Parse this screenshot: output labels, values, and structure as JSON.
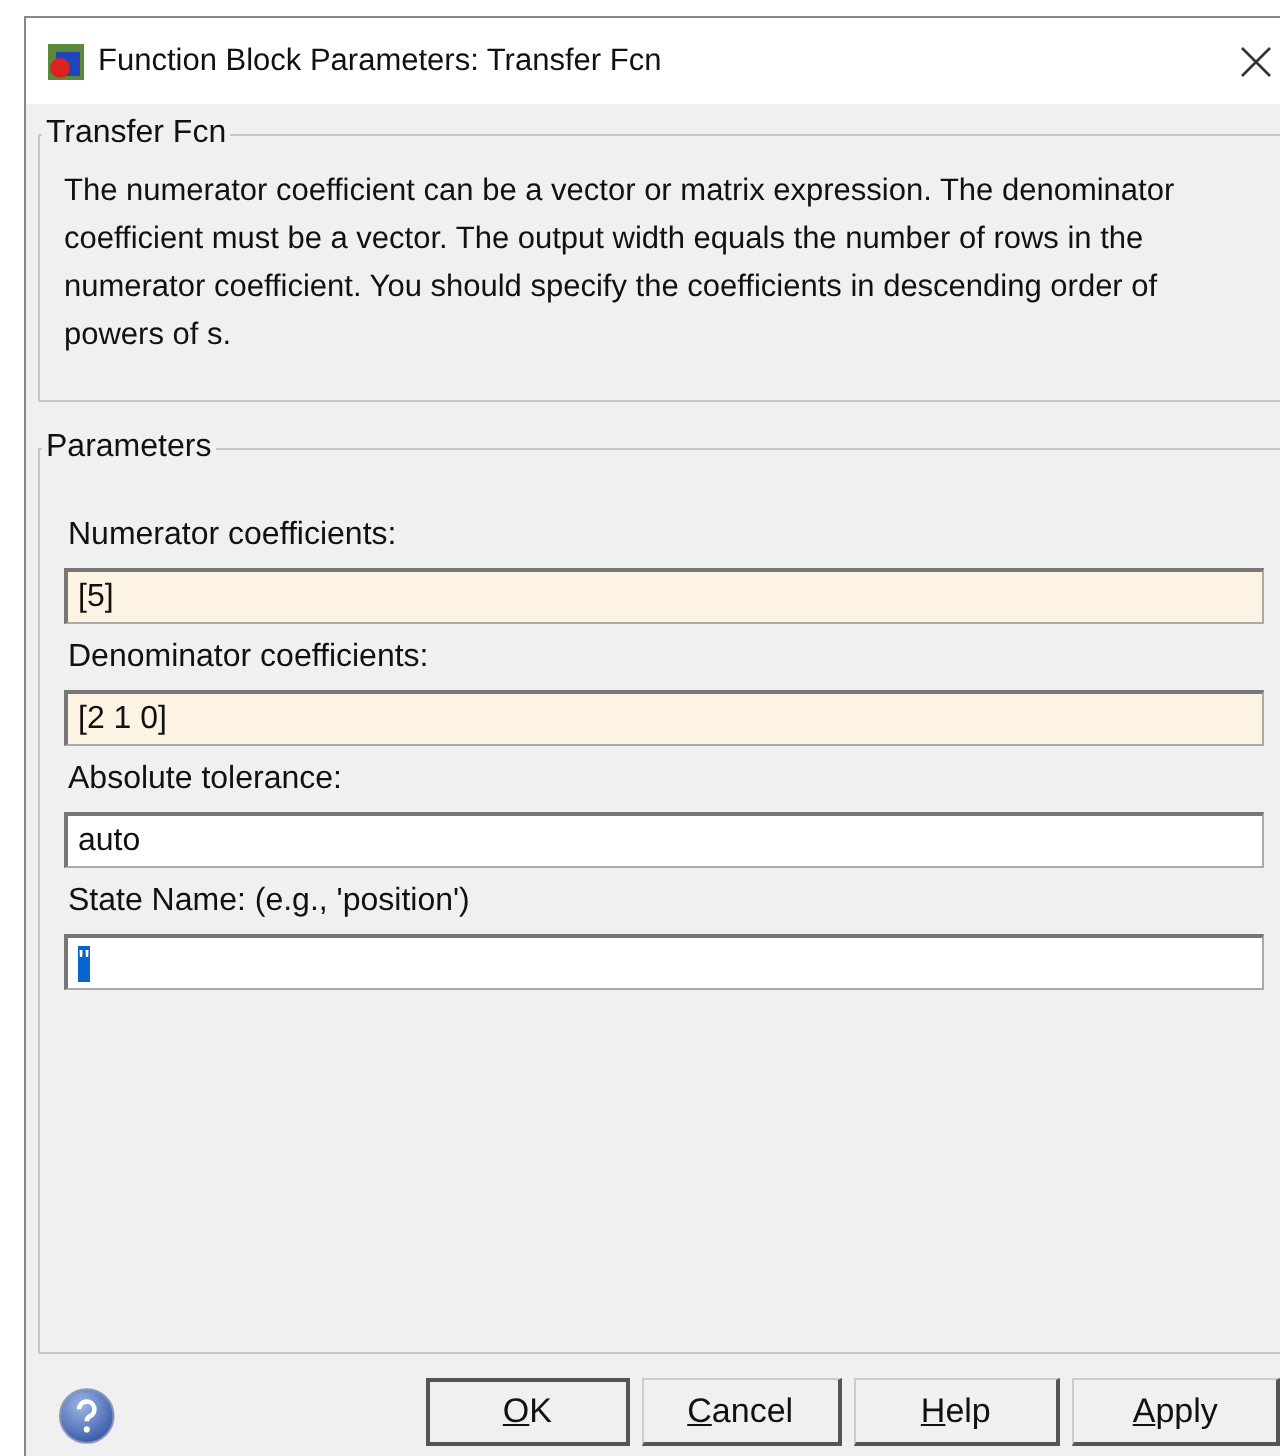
{
  "window": {
    "title": "Function Block Parameters: Transfer Fcn"
  },
  "description": {
    "legend": "Transfer Fcn",
    "text": "The numerator coefficient can be a vector or matrix expression. The denominator coefficient must be a vector. The output width equals the number of rows in the numerator coefficient. You should specify the coefficients in descending order of powers of s."
  },
  "parameters": {
    "legend": "Parameters",
    "fields": [
      {
        "label": "Numerator coefficients:",
        "value": "[5]",
        "kind": "tunable",
        "selected": false
      },
      {
        "label": "Denominator coefficients:",
        "value": "[2 1 0]",
        "kind": "tunable",
        "selected": false
      },
      {
        "label": "Absolute tolerance:",
        "value": "auto",
        "kind": "plain",
        "selected": false
      },
      {
        "label": "State Name: (e.g., 'position')",
        "value": "''",
        "kind": "plain",
        "selected": true
      }
    ]
  },
  "buttons": [
    "OK",
    "Cancel",
    "Help",
    "Apply"
  ]
}
